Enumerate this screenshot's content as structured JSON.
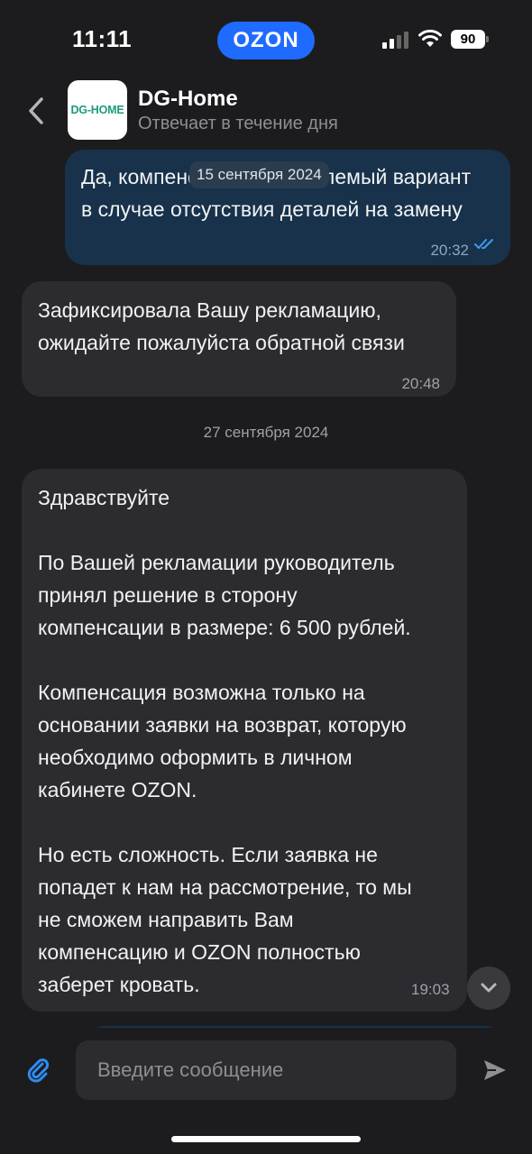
{
  "status_bar": {
    "time": "11:11",
    "app_badge": "OZON",
    "battery": "90"
  },
  "header": {
    "avatar_text": "DG-HOME",
    "name": "DG-Home",
    "subtitle": "Отвечает в течение дня"
  },
  "messages": [
    {
      "direction": "outgoing",
      "text": "Да, компенсация - приемлемый вариант\nв случае отсутствия деталей на замену",
      "time": "20:32",
      "status": "read"
    },
    {
      "direction": "incoming",
      "text": "Зафиксировала Вашу рекламацию,\nожидайте пожалуйста обратной связи",
      "time": "20:48"
    },
    {
      "direction": "incoming",
      "text": "Здравствуйте\n\nПо Вашей рекламации руководитель\nпринял решение в сторону\nкомпенсации в размере: 6 500 рублей.\n\nКомпенсация возможна только на\nосновании заявки на возврат, которую\nнеобходимо оформить в личном\nкабинете OZON.\n\nНо есть сложность. Если заявка не\nпопадет к нам на рассмотрение, то мы\nне сможем направить Вам\nкомпенсацию и OZON полностью\nзаберет кровать.",
      "time": "19:03"
    }
  ],
  "dates": {
    "floating": "15 сентября 2024",
    "separator": "27 сентября 2024"
  },
  "input": {
    "placeholder": "Введите сообщение"
  },
  "colors": {
    "background": "#1c1c1f",
    "outgoing_bubble": "#17324a",
    "incoming_bubble": "#2c2c30",
    "accent": "#1f6bff",
    "read_ticks": "#3d9cf5"
  }
}
